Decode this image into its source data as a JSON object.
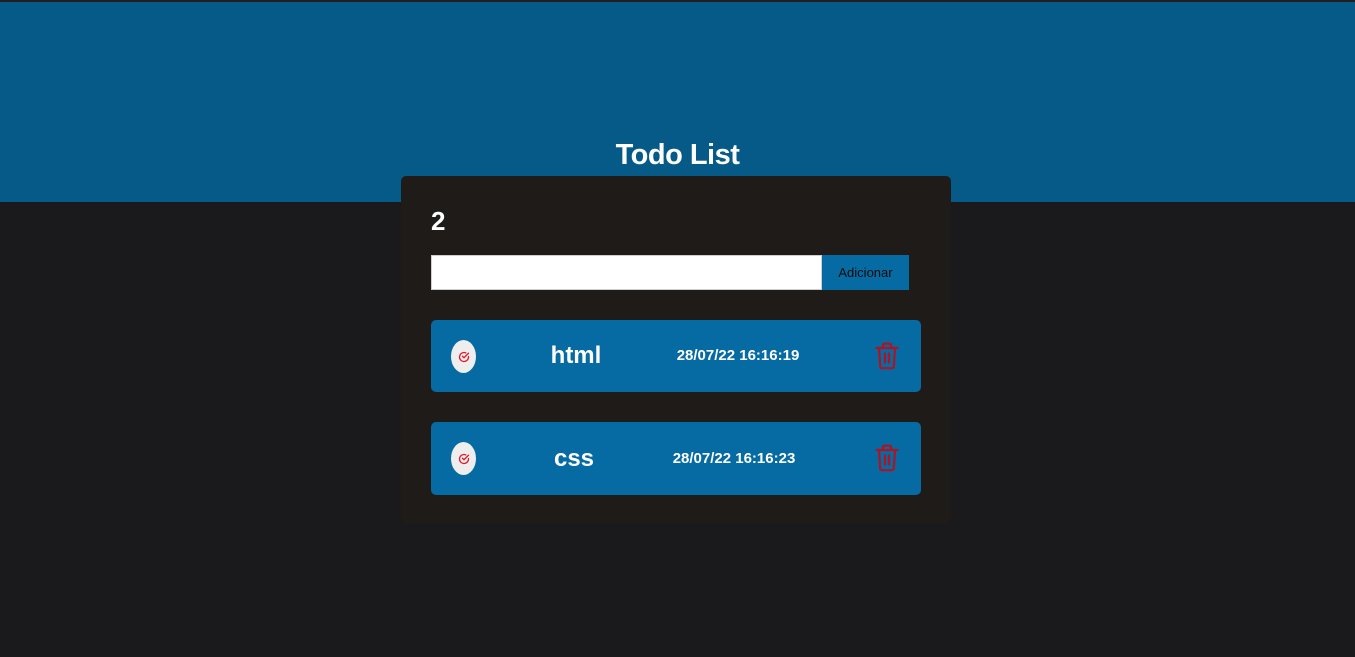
{
  "app": {
    "title": "Todo List",
    "task_count": "2"
  },
  "add_form": {
    "input_value": "",
    "button_label": "Adicionar"
  },
  "todos": [
    {
      "name": "html",
      "date": "28/07/22 16:16:19"
    },
    {
      "name": "css",
      "date": "28/07/22 16:16:23"
    }
  ],
  "colors": {
    "header_bg": "#065a87",
    "page_bg": "#1a191b",
    "card_bg": "#1f1b19",
    "item_bg": "#066aa3",
    "delete_icon": "#b01322",
    "check_icon": "#e01b2a"
  },
  "icons": {
    "check": "check-circle-icon",
    "delete": "trash-icon"
  }
}
